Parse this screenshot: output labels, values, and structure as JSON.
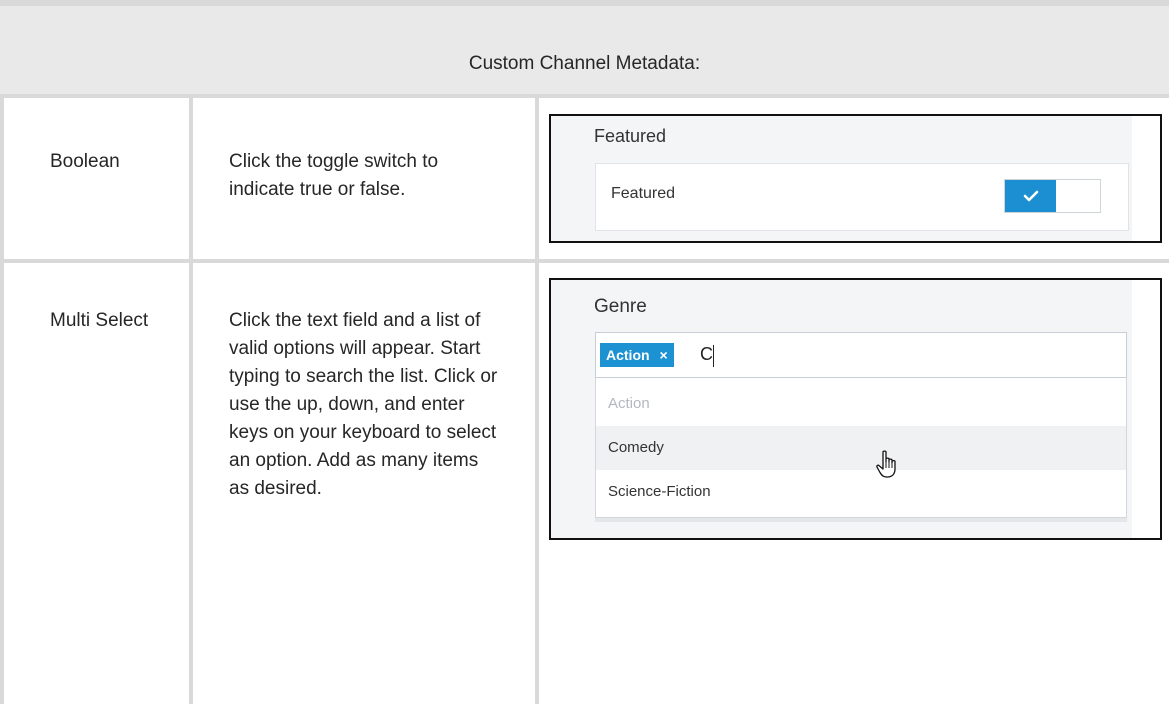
{
  "table": {
    "header": "Custom Channel Metadata:",
    "rows": [
      {
        "type": "Boolean",
        "description": "Click the toggle switch to indicate true or false."
      },
      {
        "type": "Multi Select",
        "description": "Click the text field and a list of valid options will appear. Start typing to search the list. Click or use the up, down, and enter keys on your keyboard to select an option. Add as many items as desired."
      }
    ]
  },
  "boolean_example": {
    "section_title": "Featured",
    "field_label": "Featured",
    "toggle_state": true,
    "toggle_color": "#1b8fd1"
  },
  "multiselect_example": {
    "section_title": "Genre",
    "selected_tag": "Action",
    "tag_remove_glyph": "×",
    "typed_text": "C",
    "options": [
      "Action",
      "Comedy",
      "Science-Fiction"
    ],
    "disabled_option": "Action",
    "hovered_option": "Comedy",
    "tag_color": "#1c92d3"
  }
}
